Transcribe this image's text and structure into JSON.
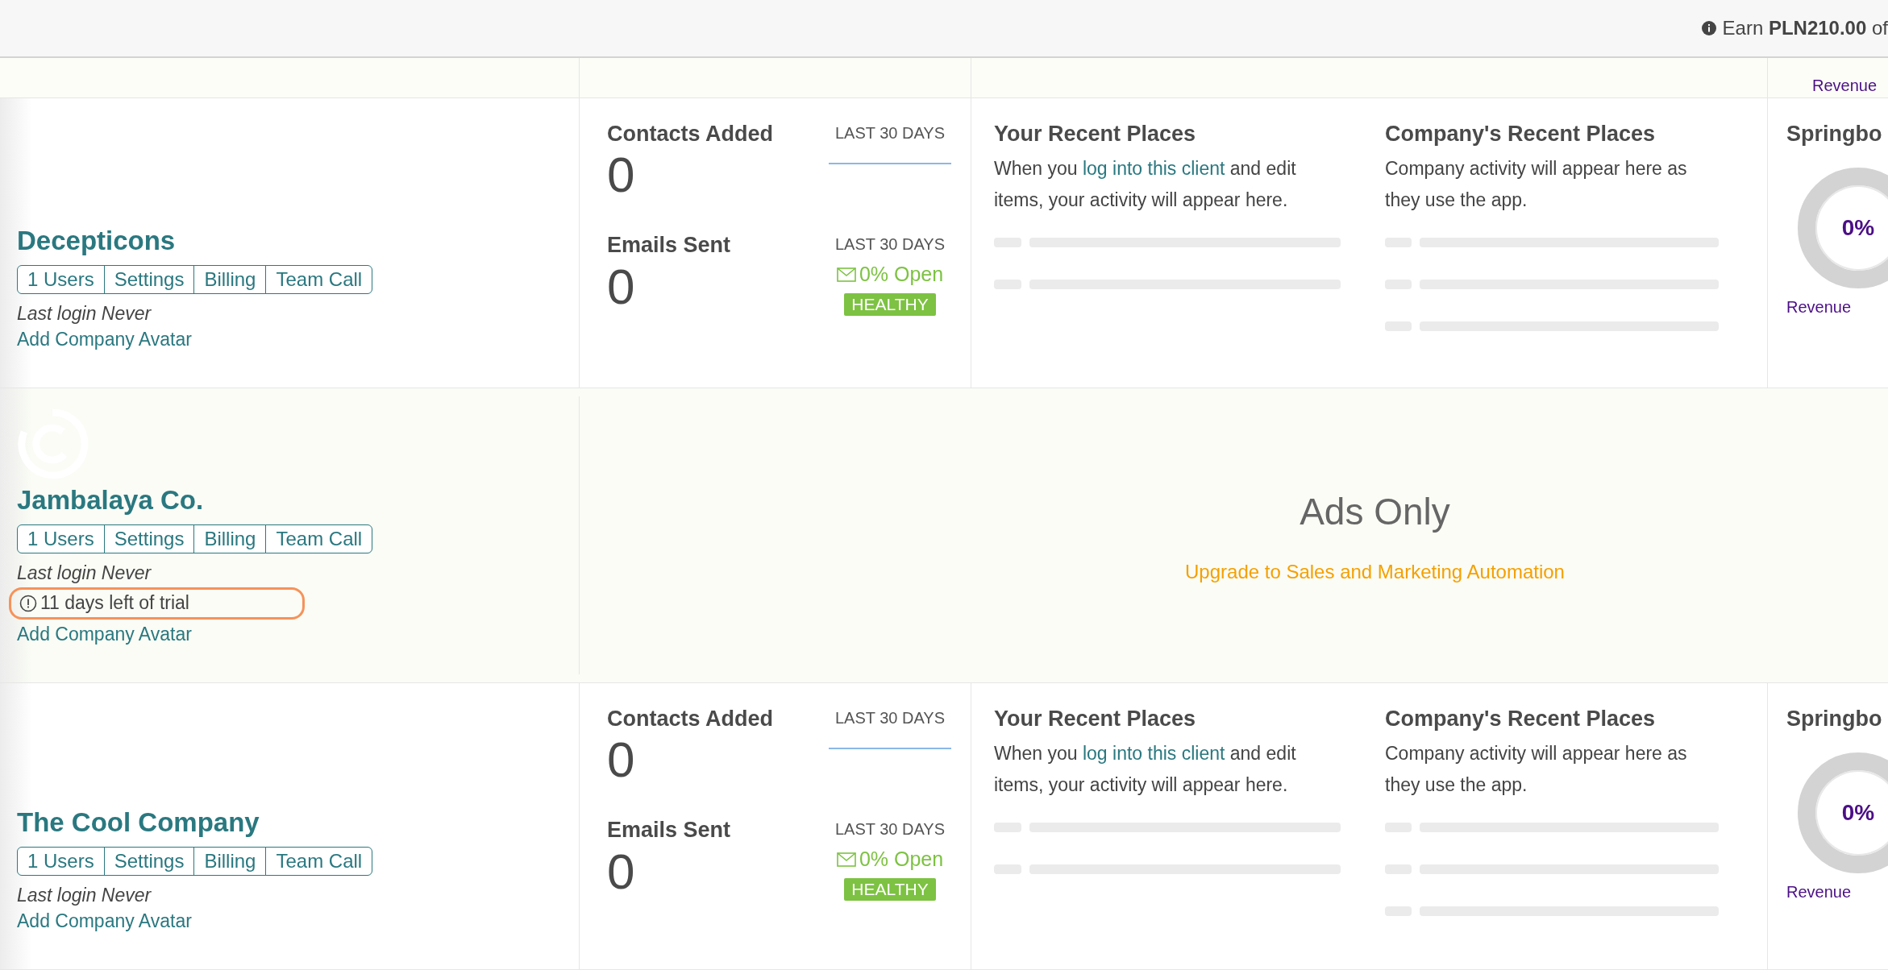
{
  "top_bar": {
    "promo": "Earn **PLN210.00** of"
  },
  "partial_row": {
    "revenue_label": "Revenue"
  },
  "companies": [
    {
      "kind": "full",
      "name": "Decepticons",
      "buttons": [
        "1 Users",
        "Settings",
        "Billing",
        "Team Call"
      ],
      "last_login": "Last login Never",
      "avatar_link": "Add Company Avatar",
      "stats": {
        "contacts_title": "Contacts Added",
        "contacts_value": "0",
        "contacts_period": "LAST 30 DAYS",
        "emails_title": "Emails Sent",
        "emails_value": "0",
        "emails_period": "LAST 30 DAYS",
        "open_rate": "0% Open",
        "health": "HEALTHY"
      },
      "your_places": {
        "title": "Your Recent Places",
        "text_before": "When you ",
        "link": "log into this client",
        "text_after": " and edit items, your activity will appear here."
      },
      "company_places": {
        "title": "Company's Recent Places",
        "text": "Company activity will appear here as they use the app."
      },
      "springboard": {
        "title": "Springbo",
        "value": "0%",
        "label": "Revenue"
      }
    },
    {
      "kind": "ads_only",
      "name": "Jambalaya Co.",
      "buttons": [
        "1 Users",
        "Settings",
        "Billing",
        "Team Call"
      ],
      "last_login": "Last login Never",
      "trial": {
        "text": "11 days left of trial",
        "highlighted": true
      },
      "avatar_link": "Add Company Avatar",
      "ads_only": {
        "title": "Ads Only",
        "link": "Upgrade to Sales and Marketing Automation"
      }
    },
    {
      "kind": "full",
      "name": "The Cool Company",
      "buttons": [
        "1 Users",
        "Settings",
        "Billing",
        "Team Call"
      ],
      "last_login": "Last login Never",
      "avatar_link": "Add Company Avatar",
      "stats": {
        "contacts_title": "Contacts Added",
        "contacts_value": "0",
        "contacts_period": "LAST 30 DAYS",
        "emails_title": "Emails Sent",
        "emails_value": "0",
        "emails_period": "LAST 30 DAYS",
        "open_rate": "0% Open",
        "health": "HEALTHY"
      },
      "your_places": {
        "title": "Your Recent Places",
        "text_before": "When you ",
        "link": "log into this client",
        "text_after": " and edit items, your activity will appear here."
      },
      "company_places": {
        "title": "Company's Recent Places",
        "text": "Company activity will appear here as they use the app."
      },
      "springboard": {
        "title": "Springbo",
        "value": "0%",
        "label": "Revenue"
      }
    }
  ]
}
